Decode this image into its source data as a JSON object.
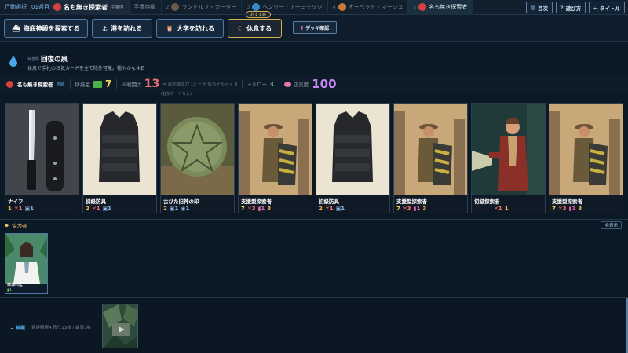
{
  "topbar": {
    "phase": "行動選択",
    "week": "01週目",
    "tabs": [
      {
        "num": "",
        "name": "名も無き探索者",
        "note": "手番中",
        "current": true
      },
      {
        "num": "",
        "name": "手番待機",
        "note": "",
        "current": false
      },
      {
        "num": "2",
        "name": "ランドルフ・カーター",
        "note": "",
        "current": false
      },
      {
        "num": "3",
        "name": "ヘンリー・アーミテッジ",
        "note": "",
        "current": false
      },
      {
        "num": "4",
        "name": "オーベッド・マーシュ",
        "note": "",
        "current": false
      },
      {
        "num": "5",
        "name": "名も無き探索者",
        "note": "",
        "current": false
      }
    ],
    "buttons": [
      {
        "icon": "book-icon",
        "label": "目次"
      },
      {
        "icon": "question-icon",
        "label": "遊び方"
      },
      {
        "icon": "back-arrow-icon",
        "label": "← タイトル"
      }
    ]
  },
  "actions": [
    {
      "label": "海底神殿を探索する",
      "icon": "ship-icon"
    },
    {
      "label": "港を訪れる",
      "icon": "anchor-icon"
    },
    {
      "label": "大学を訪れる",
      "icon": "owl-icon"
    },
    {
      "label": "休息する",
      "icon": "moon-icon",
      "recommended": true
    }
  ],
  "recommend_badge": "おすすめ",
  "deck_button": "デッキ確認",
  "location": {
    "category": "休息所",
    "name": "回復の泉",
    "description": "休息で手札の狂気カードを全て除外可能。穏やかな休日"
  },
  "status": {
    "character": "名も無き探索者",
    "role": "医師",
    "money_label": "所持金",
    "money": "7",
    "power_label": "戦闘力",
    "power": "13",
    "power_detail": "= 合計戦闘力 13 ー 狂気ペナルティ 0",
    "power_note": "(狂気カードなし)",
    "draw_label": "+ドロー",
    "draw": "3",
    "sanity_label": "正気度",
    "sanity": "100"
  },
  "cards": [
    {
      "name": "ナイフ",
      "stats": [
        {
          "v": "1",
          "c": "o"
        },
        {
          "v": "✕1",
          "c": "r"
        },
        {
          "v": "▣1",
          "c": "b"
        }
      ]
    },
    {
      "name": "初級防具",
      "stats": [
        {
          "v": "2",
          "c": "o"
        },
        {
          "v": "✕1",
          "c": "r"
        },
        {
          "v": "▣1",
          "c": "b"
        }
      ]
    },
    {
      "name": "古びた旧神の印",
      "stats": [
        {
          "v": "2",
          "c": "o"
        },
        {
          "v": "▣1",
          "c": "b"
        },
        {
          "v": "◉1",
          "c": "b"
        }
      ]
    },
    {
      "name": "支援型探索者",
      "stats": [
        {
          "v": "7",
          "c": "y"
        },
        {
          "v": "✕3",
          "c": "r"
        },
        {
          "v": "▮1",
          "c": "p"
        },
        {
          "v": "3",
          "c": "o"
        }
      ]
    },
    {
      "name": "初級防具",
      "stats": [
        {
          "v": "2",
          "c": "o"
        },
        {
          "v": "✕1",
          "c": "r"
        },
        {
          "v": "▣1",
          "c": "b"
        }
      ]
    },
    {
      "name": "支援型探索者",
      "stats": [
        {
          "v": "7",
          "c": "y"
        },
        {
          "v": "✕3",
          "c": "r"
        },
        {
          "v": "▮1",
          "c": "p"
        },
        {
          "v": "3",
          "c": "o"
        }
      ]
    },
    {
      "name": "初級探索者",
      "stats": [
        {
          "v": "✕1",
          "c": "r"
        },
        {
          "v": "1",
          "c": "o"
        }
      ]
    },
    {
      "name": "支援型探索者",
      "stats": [
        {
          "v": "7",
          "c": "y"
        },
        {
          "v": "✕3",
          "c": "r"
        },
        {
          "v": "▮1",
          "c": "p"
        },
        {
          "v": "3",
          "c": "o"
        }
      ]
    }
  ],
  "ally": {
    "header": "協力者",
    "toggle": "非表示",
    "card_name": "精神科医",
    "card_stat": "▮1"
  },
  "bottom": {
    "label": "神殿",
    "info": "到達階層4 残り13枚 / 最表7枚"
  },
  "colors": {
    "background": "#0b1826",
    "accent_blue": "#4f7aa6",
    "recommend_gold": "#d6b24a",
    "money": "#f1d24e",
    "power": "#f07070",
    "draw": "#6fd06f",
    "sanity": "#c486f0"
  }
}
